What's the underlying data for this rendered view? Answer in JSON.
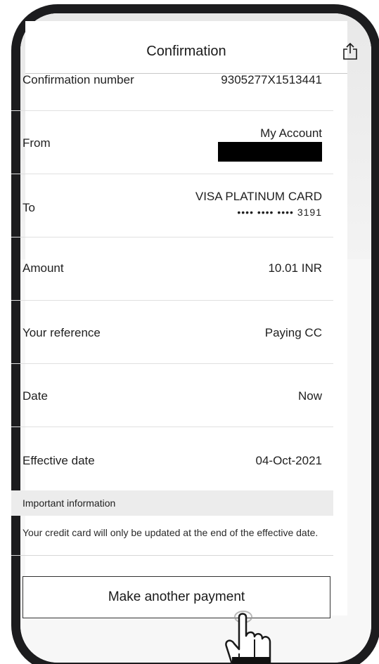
{
  "header": {
    "title": "Confirmation",
    "share_icon": "share-icon"
  },
  "details": {
    "confirmation_number": {
      "label": "Confirmation number",
      "value": "9305277X1513441"
    },
    "from": {
      "label": "From",
      "value": "My Account"
    },
    "to": {
      "label": "To",
      "value": "VISA PLATINUM CARD",
      "masked_number": "•••• •••• •••• 3191"
    },
    "amount": {
      "label": "Amount",
      "value": "10.01 INR"
    },
    "reference": {
      "label": "Your reference",
      "value": "Paying CC"
    },
    "date": {
      "label": "Date",
      "value": "Now"
    },
    "effective_date": {
      "label": "Effective date",
      "value": "04-Oct-2021"
    }
  },
  "important": {
    "title": "Important information",
    "text": "Your credit card will only be updated at the end of the effective date."
  },
  "actions": {
    "make_another_payment": "Make another payment"
  },
  "colors": {
    "frame": "#1c1c1e",
    "text": "#1f1f1f",
    "info_bg": "#ececec",
    "redaction": "#000000"
  }
}
